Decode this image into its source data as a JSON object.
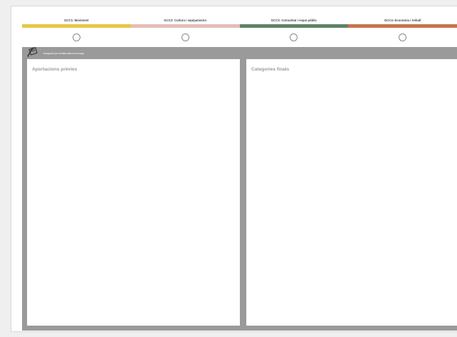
{
  "tabs": [
    {
      "label": "GCC1: Moviment",
      "color": "#e8c547"
    },
    {
      "label": "GCC2: Cultura i equipaments",
      "color": "#e3beb5"
    },
    {
      "label": "GCC3: Comunitat i espai públic",
      "color": "#5f8265"
    },
    {
      "label": "GCC4: Economia i treball",
      "color": "#c8734d"
    }
  ],
  "board": {
    "caption": "Categories per al Taller Obert 3 de maig",
    "icon": "pen-icon",
    "left_panel": {
      "title": "Aportacions prèvies"
    },
    "right_panel": {
      "title": "Categories finals"
    }
  }
}
